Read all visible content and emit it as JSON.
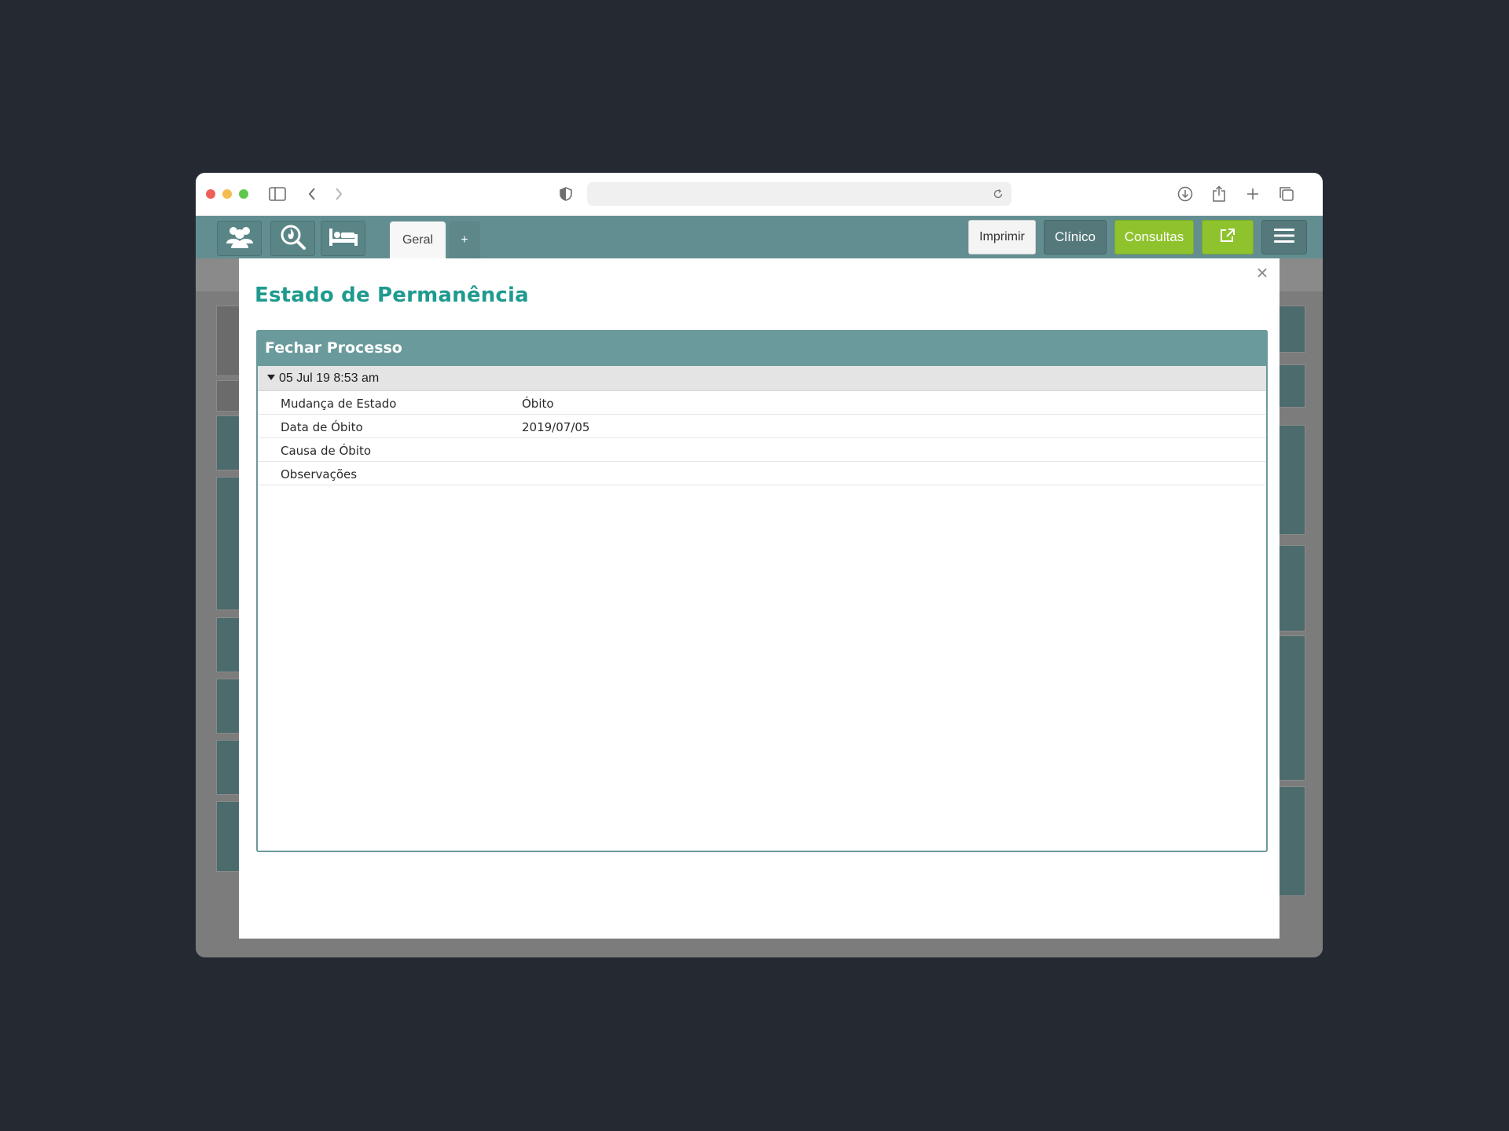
{
  "toolbar": {
    "tabs": [
      {
        "label": "Geral"
      },
      {
        "label": "+"
      }
    ],
    "buttons": {
      "imprimir": "Imprimir",
      "clinico": "Clínico",
      "consultas": "Consultas"
    },
    "icons": [
      "patients-icon",
      "search-flame-icon",
      "bed-icon",
      "external-link-icon",
      "hamburger-menu-icon"
    ]
  },
  "modal": {
    "title": "Estado de Permanência",
    "panel": {
      "title": "Fechar Processo",
      "group_header": "05 Jul 19 8:53 am",
      "rows": [
        {
          "label": "Mudança de Estado",
          "value": "Óbito"
        },
        {
          "label": "Data de Óbito",
          "value": "2019/07/05"
        },
        {
          "label": "Causa de Óbito",
          "value": ""
        },
        {
          "label": "Observações",
          "value": ""
        }
      ]
    }
  },
  "colors": {
    "header_bg": "#628e91",
    "title_teal": "#1f9a8f",
    "panel_head": "#6a9a9c",
    "accent_green": "#8fc32e"
  }
}
